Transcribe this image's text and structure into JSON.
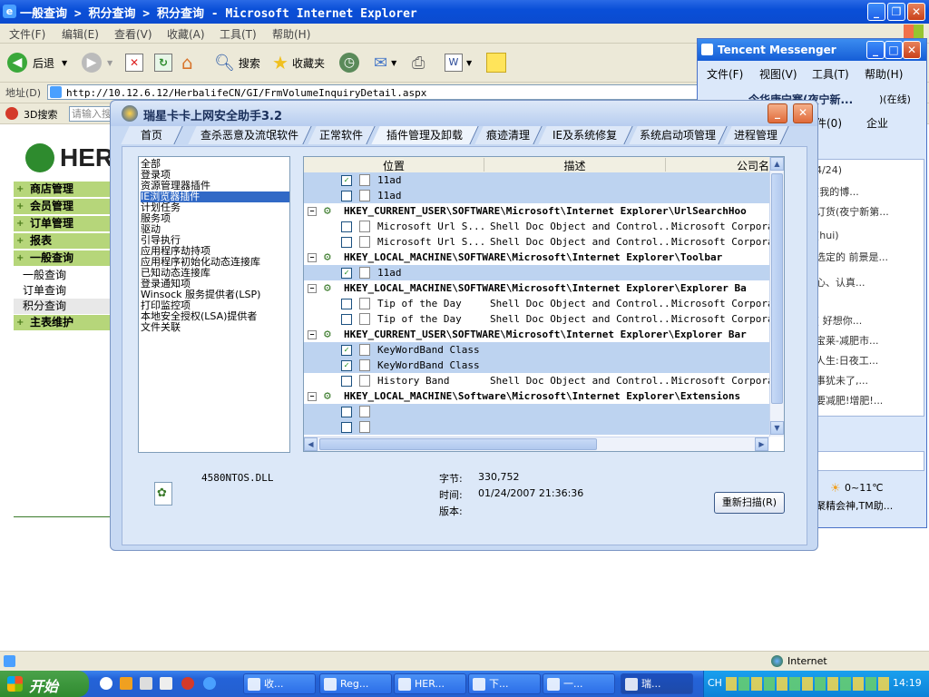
{
  "ie": {
    "title": "一般查询 > 积分查询 > 积分查询 - Microsoft Internet Explorer",
    "menu": [
      "文件(F)",
      "编辑(E)",
      "查看(V)",
      "收藏(A)",
      "工具(T)",
      "帮助(H)"
    ],
    "toolbar": {
      "back": "后退",
      "search": "搜索",
      "favorites": "收藏夹"
    },
    "address_label": "地址(D)",
    "address_url": "http://10.12.6.12/HerbalifeCN/GI/FrmVolumeInquiryDetail.aspx",
    "links_label": "3D搜索",
    "links_placeholder": "请输入搜",
    "status_zone": "Internet"
  },
  "page": {
    "logo_text": "HER",
    "menu": [
      {
        "label": "商店管理",
        "type": "main"
      },
      {
        "label": "会员管理",
        "type": "main"
      },
      {
        "label": "订单管理",
        "type": "main"
      },
      {
        "label": "报表",
        "type": "main"
      },
      {
        "label": "一般查询",
        "type": "main"
      },
      {
        "label": "一般查询",
        "type": "sub"
      },
      {
        "label": "订单查询",
        "type": "sub"
      },
      {
        "label": "积分查询",
        "type": "sub"
      },
      {
        "label": "主表维护",
        "type": "main"
      }
    ]
  },
  "qq": {
    "title": "Tencent Messenger",
    "menu": [
      "文件(F)",
      "视图(V)",
      "工具(T)",
      "帮助(H)"
    ],
    "status": ")(在线)",
    "contact_header": "今华康宁赛(夜宁新...",
    "tabs": [
      "件(0)",
      "企业"
    ],
    "rows": [
      "4/24)",
      "(我的博...",
      "订货(夜宁新第...",
      "(hui)",
      "选定的 前景是...",
      "心、认真...",
      "(    好想你...",
      "宝莱-减肥市...",
      "人生:日夜工...",
      "事犹未了,...",
      "要减肥!增肥!..."
    ],
    "weather": "0~11℃",
    "news": "聚精会神,TM助..."
  },
  "dialog": {
    "title": "瑞星卡卡上网安全助手3.2",
    "tabs": [
      "首页",
      "查杀恶意及流氓软件",
      "正常软件",
      "插件管理及卸载",
      "痕迹清理",
      "IE及系统修复",
      "系统启动项管理",
      "进程管理"
    ],
    "categories": [
      "全部",
      "登录项",
      "资源管理器插件",
      "IE浏览器插件",
      "计划任务",
      "服务项",
      "驱动",
      "引导执行",
      "应用程序劫持项",
      "应用程序初始化动态连接库",
      "已知动态连接库",
      "登录通知项",
      "Winsock 服务提供者(LSP)",
      "打印监控项",
      "本地安全授权(LSA)提供者",
      "文件关联"
    ],
    "selected_category": 3,
    "columns": [
      "位置",
      "描述",
      "公司名"
    ],
    "rows": [
      {
        "type": "item",
        "checked": true,
        "name": "11ad",
        "desc": "",
        "company": "",
        "hl": true
      },
      {
        "type": "item",
        "checked": false,
        "name": "11ad",
        "desc": "",
        "company": "",
        "hl": true
      },
      {
        "type": "group",
        "name": "HKEY_CURRENT_USER\\SOFTWARE\\Microsoft\\Internet Explorer\\UrlSearchHoo"
      },
      {
        "type": "item",
        "checked": false,
        "name": "Microsoft Url S...",
        "desc": "Shell Doc Object and Control...",
        "company": "Microsoft Corporat",
        "hl": false
      },
      {
        "type": "item",
        "checked": false,
        "name": "Microsoft Url S...",
        "desc": "Shell Doc Object and Control...",
        "company": "Microsoft Corporat",
        "hl": false
      },
      {
        "type": "group",
        "name": "HKEY_LOCAL_MACHINE\\SOFTWARE\\Microsoft\\Internet Explorer\\Toolbar"
      },
      {
        "type": "item",
        "checked": true,
        "name": "11ad",
        "desc": "",
        "company": "",
        "hl": true
      },
      {
        "type": "group",
        "name": "HKEY_LOCAL_MACHINE\\SOFTWARE\\Microsoft\\Internet Explorer\\Explorer Ba"
      },
      {
        "type": "item",
        "checked": false,
        "name": "Tip of the Day",
        "desc": "Shell Doc Object and Control...",
        "company": "Microsoft Corporat",
        "hl": false
      },
      {
        "type": "item",
        "checked": false,
        "name": "Tip of the Day",
        "desc": "Shell Doc Object and Control...",
        "company": "Microsoft Corporat",
        "hl": false
      },
      {
        "type": "group",
        "name": "HKEY_CURRENT_USER\\SOFTWARE\\Microsoft\\Internet Explorer\\Explorer Bar"
      },
      {
        "type": "item",
        "checked": true,
        "name": "KeyWordBand Class",
        "desc": "",
        "company": "",
        "hl": true
      },
      {
        "type": "item",
        "checked": true,
        "name": "KeyWordBand Class",
        "desc": "",
        "company": "",
        "hl": true
      },
      {
        "type": "item",
        "checked": false,
        "name": "History Band",
        "desc": "Shell Doc Object and Control...",
        "company": "Microsoft Corporat",
        "hl": false
      },
      {
        "type": "group",
        "name": "HKEY_LOCAL_MACHINE\\Software\\Microsoft\\Internet Explorer\\Extensions"
      },
      {
        "type": "item",
        "checked": false,
        "name": "",
        "desc": "",
        "company": "",
        "hl": true
      },
      {
        "type": "item",
        "checked": false,
        "name": "",
        "desc": "",
        "company": "",
        "hl": true
      }
    ],
    "file_name": "4580NTOS.DLL",
    "bytes_label": "字节:",
    "bytes_value": "330,752",
    "time_label": "时间:",
    "time_value": "01/24/2007 21:36:36",
    "version_label": "版本:",
    "rescan_label": "重新扫描(R)"
  },
  "taskbar": {
    "start": "开始",
    "tasks": [
      "收...",
      "Reg...",
      "HER...",
      "下...",
      "一...",
      "瑞..."
    ],
    "ime": "CH",
    "clock": "14:19"
  }
}
